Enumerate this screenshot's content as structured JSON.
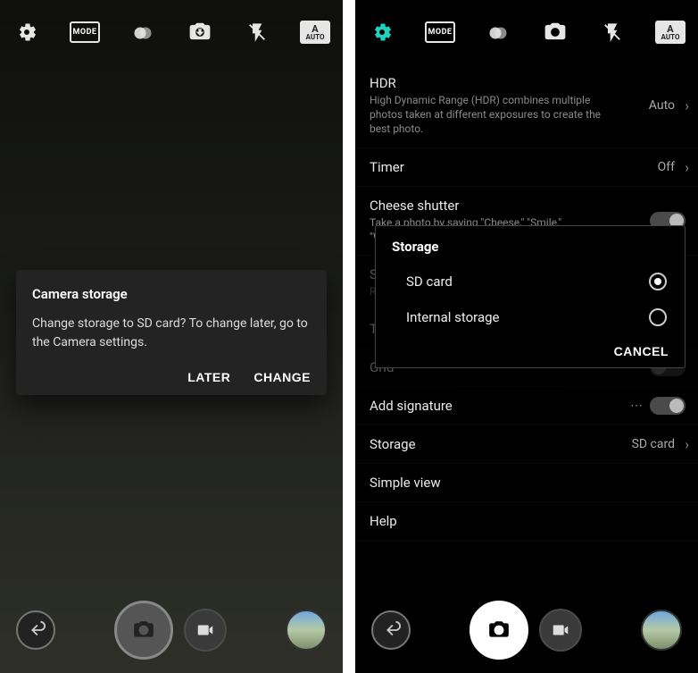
{
  "left": {
    "topbar": {
      "mode": "MODE",
      "auto_a": "A",
      "auto_label": "AUTO"
    },
    "dialog": {
      "title": "Camera storage",
      "body": "Change storage to SD card? To change later, go to the Camera settings.",
      "later": "LATER",
      "change": "CHANGE"
    }
  },
  "right": {
    "topbar": {
      "mode": "MODE",
      "auto_a": "A",
      "auto_label": "AUTO"
    },
    "settings": {
      "hdr_title": "HDR",
      "hdr_desc": "High Dynamic Range (HDR) combines multiple photos taken at different exposures to create the best photo.",
      "hdr_value": "Auto",
      "timer_title": "Timer",
      "timer_value": "Off",
      "cheese_title": "Cheese shutter",
      "cheese_desc": "Take a photo by saying \"Cheese,\" \"Smile,\" \"Whiskey,\" \"Kimchi,\" or \"LG.\"",
      "steady_title": "Steady recording",
      "steady_desc": "Reduces motion blur in videos.",
      "tag_title": "Tag locations",
      "grid_title": "Grid",
      "signature_title": "Add signature",
      "storage_title": "Storage",
      "storage_value": "SD card",
      "simple_title": "Simple view",
      "help_title": "Help"
    },
    "popup": {
      "title": "Storage",
      "option_sd": "SD card",
      "option_internal": "Internal storage",
      "cancel": "CANCEL"
    }
  }
}
